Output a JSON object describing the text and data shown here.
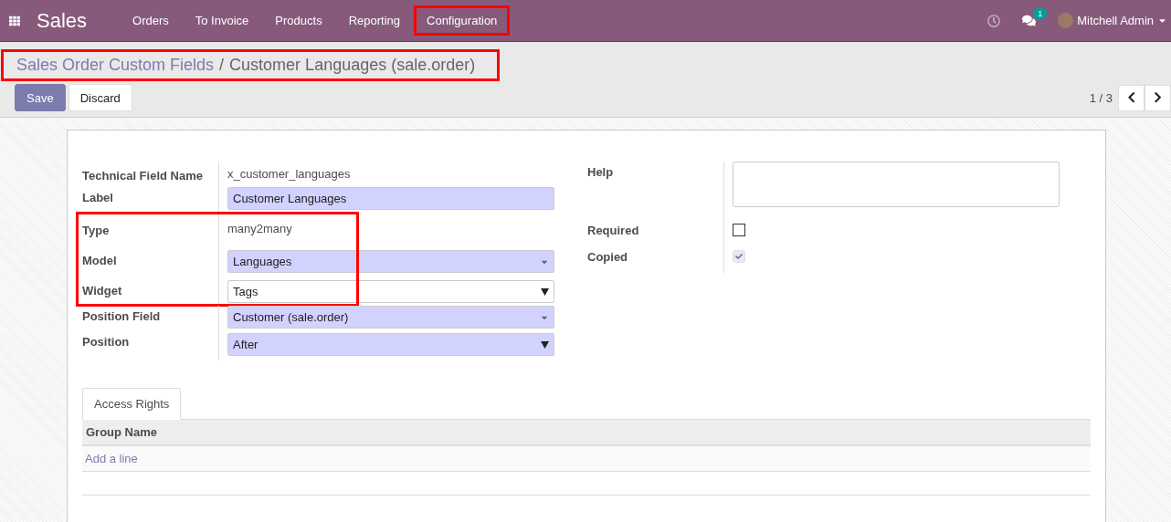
{
  "navbar": {
    "app": "Sales",
    "menu": [
      {
        "label": "Orders",
        "highlighted": false
      },
      {
        "label": "To Invoice",
        "highlighted": false
      },
      {
        "label": "Products",
        "highlighted": false
      },
      {
        "label": "Reporting",
        "highlighted": false
      },
      {
        "label": "Configuration",
        "highlighted": true
      }
    ],
    "messages_badge": "1",
    "user": "Mitchell Admin"
  },
  "breadcrumb": {
    "highlighted": true,
    "parent": "Sales Order Custom Fields",
    "separator": "/",
    "current": "Customer Languages (sale.order)"
  },
  "buttons": [
    {
      "label": "Save",
      "kind": "primary"
    },
    {
      "label": "Discard",
      "kind": "secondary"
    }
  ],
  "pager": "1 / 3",
  "left_groups": [
    {
      "highlighted": false,
      "fields": [
        {
          "label": "Technical Field Name",
          "kind": "text",
          "value": "x_customer_languages"
        },
        {
          "label": "Label",
          "kind": "input",
          "required": true,
          "value": "Customer Languages"
        }
      ]
    },
    {
      "highlighted": true,
      "fields": [
        {
          "label": "Type",
          "kind": "text",
          "value": "many2many"
        },
        {
          "label": "Model",
          "kind": "many2one",
          "required": true,
          "value": "Languages"
        },
        {
          "label": "Widget",
          "kind": "selection",
          "required": false,
          "value": "Tags"
        }
      ]
    },
    {
      "highlighted": false,
      "fields": [
        {
          "label": "Position Field",
          "kind": "many2one",
          "required": true,
          "value": "Customer (sale.order)"
        },
        {
          "label": "Position",
          "kind": "selection",
          "required": true,
          "value": "After"
        }
      ]
    }
  ],
  "right_fields": [
    {
      "label": "Help",
      "kind": "textarea"
    },
    {
      "label": "Required",
      "kind": "checkbox",
      "checked": false,
      "disabled": false
    },
    {
      "label": "Copied",
      "kind": "checkbox",
      "checked": true,
      "disabled": true
    }
  ],
  "tabs": [
    {
      "label": "Access Rights",
      "selected": true
    }
  ],
  "table": {
    "columns": [
      "Group Name"
    ],
    "add_line": "Add a line"
  }
}
